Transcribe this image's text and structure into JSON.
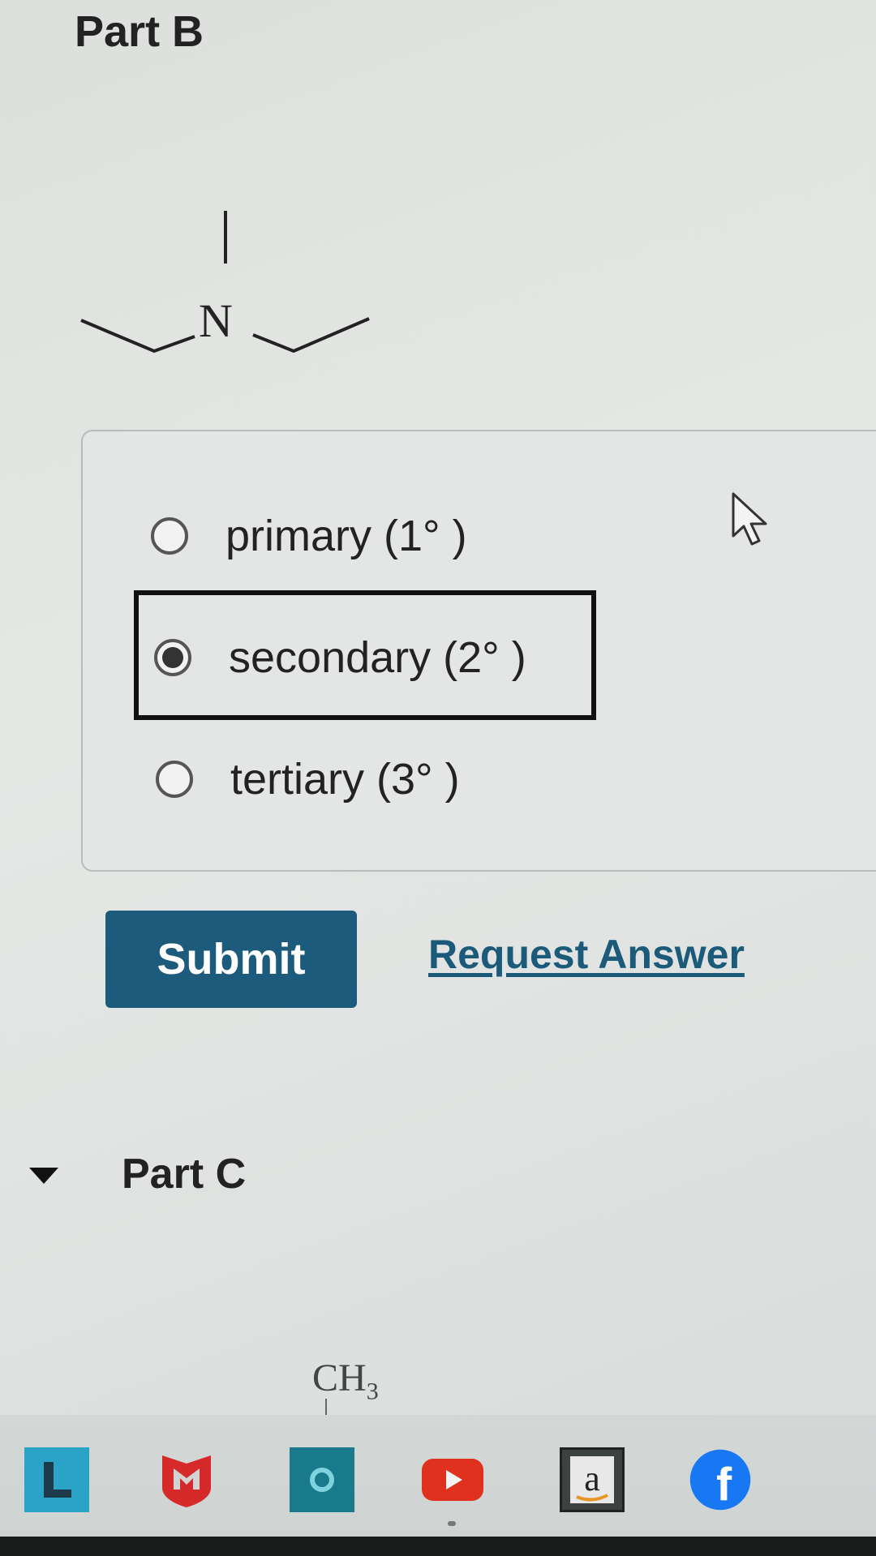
{
  "part_b": {
    "title": "Part B",
    "molecule_atom": "N"
  },
  "options": [
    {
      "label": "primary (1° )",
      "selected": false
    },
    {
      "label": "secondary (2° )",
      "selected": true
    },
    {
      "label": "tertiary (3° )",
      "selected": false
    }
  ],
  "actions": {
    "submit_label": "Submit",
    "request_answer_label": "Request Answer"
  },
  "part_c": {
    "title": "Part C",
    "molecule_text": "CH",
    "molecule_subscript": "3"
  },
  "taskbar": {
    "icons": [
      "l-app-icon",
      "mcafee-icon",
      "cortana-icon",
      "youtube-icon",
      "amazon-icon",
      "facebook-icon"
    ],
    "amazon_glyph": "a",
    "facebook_glyph": "f"
  },
  "colors": {
    "submit_bg": "#1d5b7c",
    "link": "#1c5a7a"
  }
}
